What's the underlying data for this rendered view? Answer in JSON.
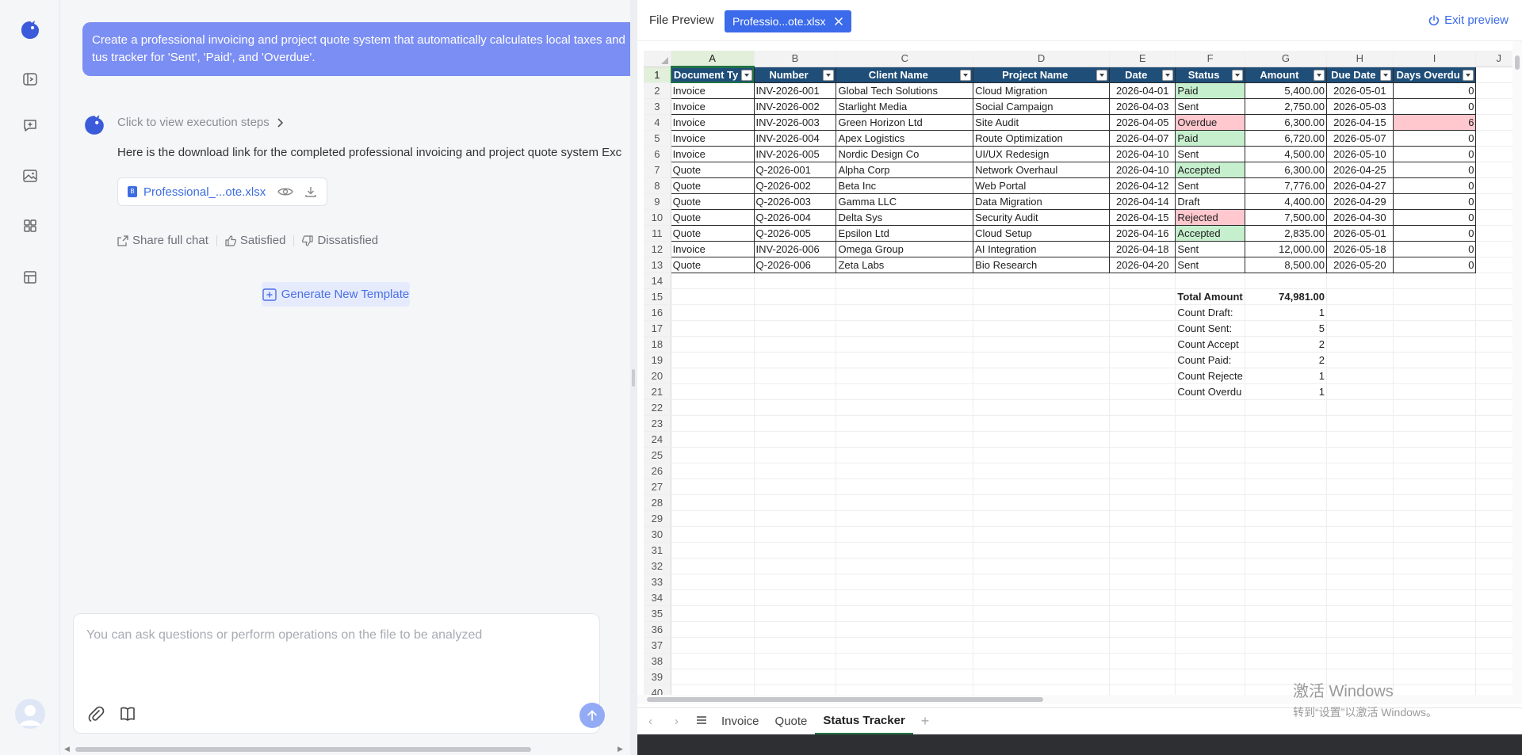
{
  "chat": {
    "user_message_line1": "Create a professional invoicing and project quote system that automatically calculates local taxes and",
    "user_message_line2": "tus tracker for 'Sent', 'Paid', and 'Overdue'.",
    "exec_steps_label": "Click to view execution steps",
    "answer_text": "Here is the download link for the completed professional invoicing and project quote system Exc",
    "file_name": "Professional_...ote.xlsx",
    "share_label": "Share full chat",
    "satisfied_label": "Satisfied",
    "dissatisfied_label": "Dissatisfied",
    "generate_label": "Generate New Template",
    "input_placeholder": "You can ask questions or perform operations on the file to be analyzed"
  },
  "preview": {
    "title": "File Preview",
    "tab_label": "Professio...ote.xlsx",
    "exit_label": "Exit preview"
  },
  "sheet": {
    "columns": [
      "A",
      "B",
      "C",
      "D",
      "E",
      "F",
      "G",
      "H",
      "I",
      "J"
    ],
    "headers": [
      "Document Ty",
      "Number",
      "Client Name",
      "Project Name",
      "Date",
      "Status",
      "Amount",
      "Due Date",
      "Days Overdu"
    ],
    "rows": [
      [
        "Invoice",
        "INV-2026-001",
        "Global Tech Solutions",
        "Cloud Migration",
        "2026-04-01",
        "Paid",
        "5,400.00",
        "2026-05-01",
        "0"
      ],
      [
        "Invoice",
        "INV-2026-002",
        "Starlight Media",
        "Social Campaign",
        "2026-04-03",
        "Sent",
        "2,750.00",
        "2026-05-03",
        "0"
      ],
      [
        "Invoice",
        "INV-2026-003",
        "Green Horizon Ltd",
        "Site Audit",
        "2026-04-05",
        "Overdue",
        "6,300.00",
        "2026-04-15",
        "6"
      ],
      [
        "Invoice",
        "INV-2026-004",
        "Apex Logistics",
        "Route Optimization",
        "2026-04-07",
        "Paid",
        "6,720.00",
        "2026-05-07",
        "0"
      ],
      [
        "Invoice",
        "INV-2026-005",
        "Nordic Design Co",
        "UI/UX Redesign",
        "2026-04-10",
        "Sent",
        "4,500.00",
        "2026-05-10",
        "0"
      ],
      [
        "Quote",
        "Q-2026-001",
        "Alpha Corp",
        "Network Overhaul",
        "2026-04-10",
        "Accepted",
        "6,300.00",
        "2026-04-25",
        "0"
      ],
      [
        "Quote",
        "Q-2026-002",
        "Beta Inc",
        "Web Portal",
        "2026-04-12",
        "Sent",
        "7,776.00",
        "2026-04-27",
        "0"
      ],
      [
        "Quote",
        "Q-2026-003",
        "Gamma LLC",
        "Data Migration",
        "2026-04-14",
        "Draft",
        "4,400.00",
        "2026-04-29",
        "0"
      ],
      [
        "Quote",
        "Q-2026-004",
        "Delta Sys",
        "Security Audit",
        "2026-04-15",
        "Rejected",
        "7,500.00",
        "2026-04-30",
        "0"
      ],
      [
        "Quote",
        "Q-2026-005",
        "Epsilon Ltd",
        "Cloud Setup",
        "2026-04-16",
        "Accepted",
        "2,835.00",
        "2026-05-01",
        "0"
      ],
      [
        "Invoice",
        "INV-2026-006",
        "Omega Group",
        "AI Integration",
        "2026-04-18",
        "Sent",
        "12,000.00",
        "2026-05-18",
        "0"
      ],
      [
        "Quote",
        "Q-2026-006",
        "Zeta Labs",
        "Bio Research",
        "2026-04-20",
        "Sent",
        "8,500.00",
        "2026-05-20",
        "0"
      ]
    ],
    "summary": [
      {
        "label": "Total Amount",
        "value": "74,981.00"
      },
      {
        "label": "Count Draft:",
        "value": "1"
      },
      {
        "label": "Count Sent:",
        "value": "5"
      },
      {
        "label": "Count Accept",
        "value": "2"
      },
      {
        "label": "Count Paid:",
        "value": "2"
      },
      {
        "label": "Count Rejecte",
        "value": "1"
      },
      {
        "label": "Count Overdu",
        "value": "1"
      }
    ],
    "total_rows": 40,
    "tabs": [
      "Invoice",
      "Quote",
      "Status Tracker"
    ],
    "active_tab": "Status Tracker"
  },
  "watermark": {
    "line1": "激活 Windows",
    "line2": "转到“设置”以激活 Windows。"
  },
  "colors": {
    "accent": "#3b6bea",
    "header_fill": "#1f4e79",
    "good_fill": "#c6efce",
    "bad_fill": "#ffc7ce"
  }
}
